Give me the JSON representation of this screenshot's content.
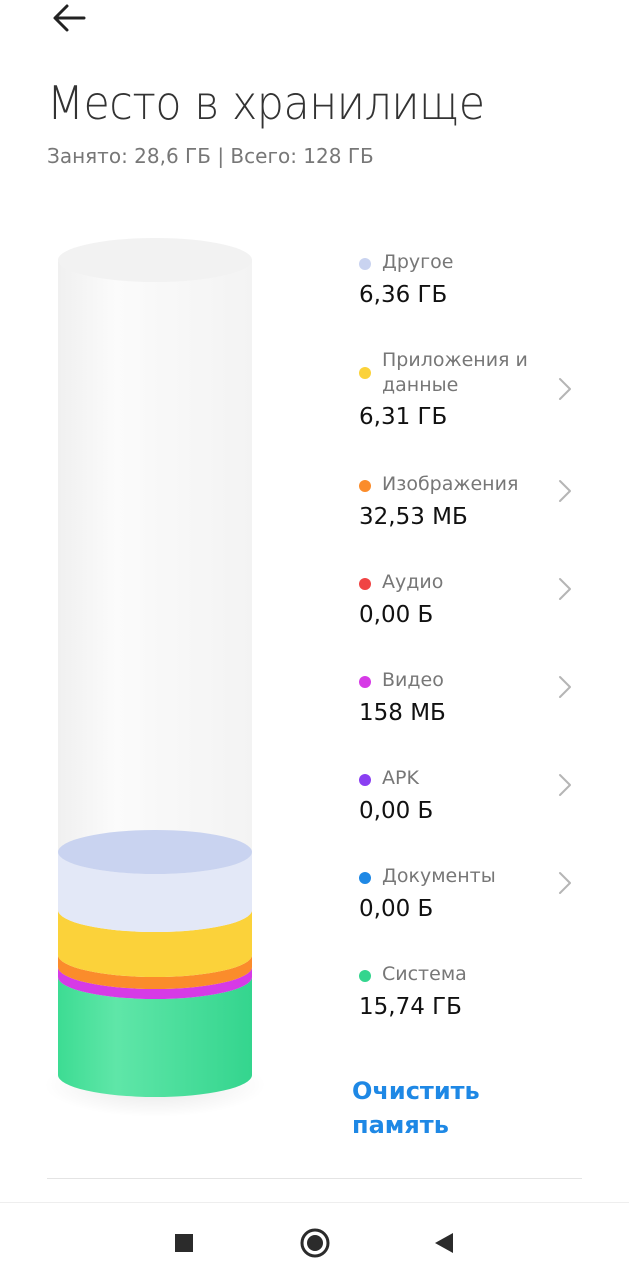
{
  "header": {
    "back_icon": "arrow-left-icon",
    "title": "Место в хранилище",
    "usage": "Занято: 28,6 ГБ | Всего: 128 ГБ"
  },
  "storage": {
    "used_gb": 28.6,
    "total_gb": 128
  },
  "categories": [
    {
      "label": "Другое",
      "value": "6,36 ГБ",
      "color": "#c9d3f0",
      "has_chevron": false
    },
    {
      "label": "Приложения и данные",
      "value": "6,31 ГБ",
      "color": "#fbd23a",
      "has_chevron": true
    },
    {
      "label": "Изображения",
      "value": "32,53 МБ",
      "color": "#fb8c2b",
      "has_chevron": true
    },
    {
      "label": "Аудио",
      "value": "0,00 Б",
      "color": "#f04444",
      "has_chevron": true
    },
    {
      "label": "Видео",
      "value": "158 МБ",
      "color": "#d63ae6",
      "has_chevron": true
    },
    {
      "label": "APK",
      "value": "0,00 Б",
      "color": "#8a3ff2",
      "has_chevron": true
    },
    {
      "label": "Документы",
      "value": "0,00 Б",
      "color": "#1e88e5",
      "has_chevron": true
    },
    {
      "label": "Система",
      "value": "15,74 ГБ",
      "color": "#34d58e",
      "has_chevron": false
    }
  ],
  "actions": {
    "clean_label": "Очистить память"
  },
  "navbar": {
    "recent_icon": "square-icon",
    "home_icon": "circle-home-icon",
    "back_icon": "triangle-back-icon"
  }
}
